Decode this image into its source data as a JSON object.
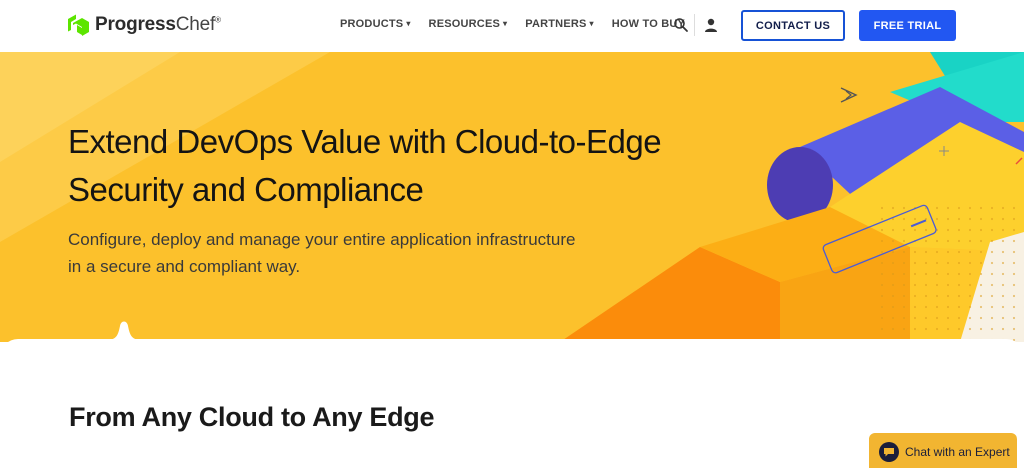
{
  "header": {
    "logo": {
      "brand": "Progress",
      "product": "Chef",
      "mark": "®"
    },
    "nav": [
      {
        "label": "PRODUCTS",
        "has_caret": true
      },
      {
        "label": "RESOURCES",
        "has_caret": true
      },
      {
        "label": "PARTNERS",
        "has_caret": true
      },
      {
        "label": "HOW TO BUY",
        "has_caret": false
      }
    ],
    "search_icon": "search-icon",
    "user_icon": "user-icon",
    "contact_label": "CONTACT US",
    "trial_label": "FREE TRIAL"
  },
  "hero": {
    "title_line1": "Extend DevOps Value with Cloud-to-Edge",
    "title_line2": "Security and Compliance",
    "subtitle_line1": "Configure, deploy and manage your entire application infrastructure",
    "subtitle_line2": "in a secure and compliant way."
  },
  "section": {
    "title": "From Any Cloud to Any Edge"
  },
  "chat": {
    "label": "Chat with an Expert",
    "icon": "chat-icon"
  },
  "colors": {
    "accent_blue": "#2257f2",
    "hero_yellow": "#fcc12c",
    "hero_orange": "#fb9a0e",
    "teal": "#19d3c5",
    "purple": "#5b5fe6"
  }
}
